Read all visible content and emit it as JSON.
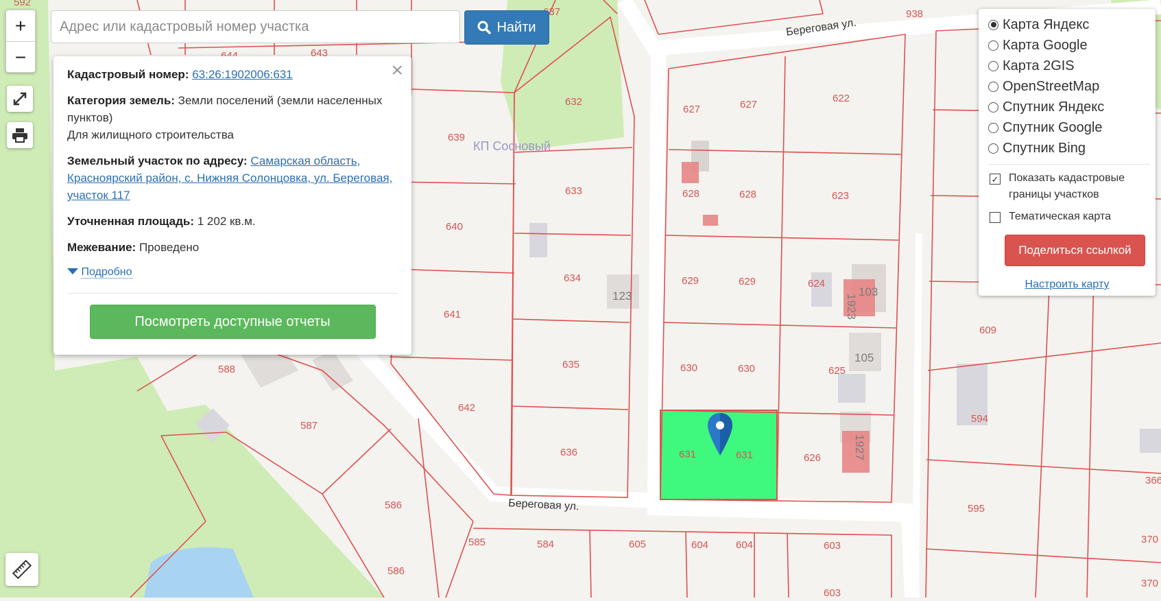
{
  "search": {
    "placeholder": "Адрес или кадастровый номер участка",
    "button_label": "Найти"
  },
  "zoom": {
    "in_label": "+",
    "out_label": "−"
  },
  "info": {
    "cad_label": "Кадастровый номер:",
    "cad_value": "63:26:1902006:631",
    "cat_label": "Категория земель:",
    "cat_value": "Земли поселений (земли населенных пунктов)",
    "use_value": "Для жилищного строительства",
    "addr_label": "Земельный участок по адресу:",
    "addr_value": "Самарская область, Красноярский район, с. Нижняя Солонцовка, ул. Береговая, участок 117",
    "area_label": "Уточненная площадь:",
    "area_value": "1 202 кв.м.",
    "survey_label": "Межевание:",
    "survey_value": "Проведено",
    "more_label": "Подробно",
    "report_button": "Посмотреть доступные отчеты"
  },
  "layers": {
    "options": [
      "Карта Яндекс",
      "Карта Google",
      "Карта 2GIS",
      "OpenStreetMap",
      "Спутник Яндекс",
      "Спутник Google",
      "Спутник Bing"
    ],
    "selected": "Карта Яндекс",
    "show_cadastral": "Показать кадастровые границы участков",
    "show_cadastral_checked": true,
    "thematic": "Тематическая карта",
    "thematic_checked": false,
    "share_button": "Поделиться ссылкой",
    "configure_link": "Настроить карту"
  },
  "map": {
    "place_name": "КП Сосновый",
    "streets": [
      "Береговая ул.",
      "Береговая ул."
    ],
    "building_labels": [
      "123",
      "103",
      "105",
      "1923",
      "1927"
    ],
    "parcel_labels": [
      "592",
      "637",
      "644",
      "643",
      "632",
      "639",
      "640",
      "641",
      "633",
      "634",
      "635",
      "636",
      "642",
      "588",
      "587",
      "586",
      "586",
      "585",
      "584",
      "605",
      "604",
      "604",
      "603",
      "603",
      "627",
      "627",
      "622",
      "628",
      "628",
      "623",
      "629",
      "629",
      "624",
      "630",
      "630",
      "625",
      "631",
      "631",
      "626",
      "938",
      "609",
      "594",
      "595",
      "366",
      "370",
      "370"
    ],
    "selected_parcel_color": "#3ef97e",
    "boundary_color": "#e05050"
  }
}
